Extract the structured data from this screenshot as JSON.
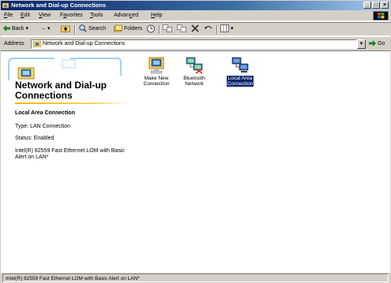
{
  "window": {
    "title": "Network and Dial-up Connections"
  },
  "title_buttons": {
    "minimize": "_",
    "maximize": "□",
    "close": "×"
  },
  "menu": [
    {
      "label": "File",
      "key": "F",
      "rest": "ile"
    },
    {
      "label": "Edit",
      "key": "E",
      "rest": "dit"
    },
    {
      "label": "View",
      "key": "V",
      "rest": "iew"
    },
    {
      "label": "Favorites",
      "key": "a",
      "pre": "F",
      "rest": "vorites"
    },
    {
      "label": "Tools",
      "key": "T",
      "rest": "ools"
    },
    {
      "label": "Advanced",
      "pre": "Advan",
      "key": "c",
      "rest": "ed"
    },
    {
      "label": "Help",
      "key": "H",
      "rest": "elp"
    }
  ],
  "toolbar": {
    "back": "Back",
    "forward": "→",
    "search": "Search",
    "folders": "Folders"
  },
  "address": {
    "label": "Address",
    "value": "Network and Dial-up Connections",
    "go": "Go"
  },
  "folder": {
    "title_line1": "Network and Dial-up",
    "title_line2": "Connections"
  },
  "details": {
    "name": "Local Area Connection",
    "type": "Type: LAN Connection",
    "status": "Status: Enabled",
    "device": "Intel(R) 82559 Fast Ethernet LOM with Basic Alert on LAN*"
  },
  "icons": [
    {
      "line1": "Make New",
      "line2": "Connection",
      "icon": "make-new-connection-icon"
    },
    {
      "line1": "Bluetooth",
      "line2": "Network",
      "icon": "bluetooth-network-icon"
    },
    {
      "line1": "Local Area",
      "line2": "Connection",
      "icon": "local-area-connection-icon",
      "selected": true
    }
  ],
  "statusbar": {
    "text": "Intel(R) 82559 Fast Ethernet LOM with Basic Alert on LAN*"
  },
  "colors": {
    "title_start": "#0a246a",
    "title_end": "#a6caf0",
    "chrome": "#d4d0c8",
    "selection": "#0a246a"
  }
}
